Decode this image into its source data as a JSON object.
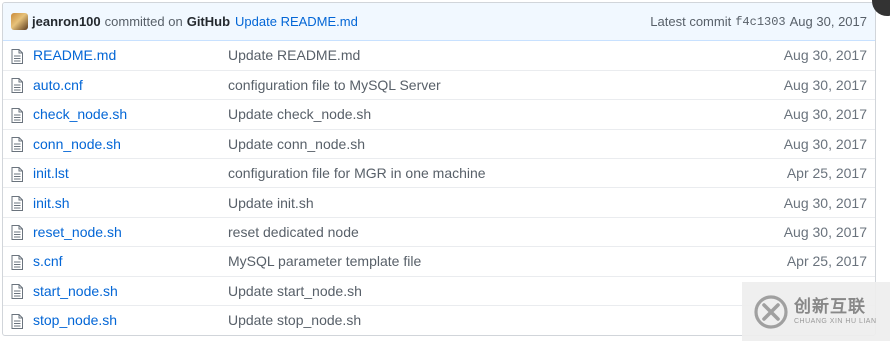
{
  "commit": {
    "author": "jeanron100",
    "committed_text": "committed on",
    "platform": "GitHub",
    "message": "Update README.md",
    "latest_label": "Latest commit",
    "sha": "f4c1303",
    "date": "Aug 30, 2017"
  },
  "files": [
    {
      "name": "README.md",
      "message": "Update README.md",
      "age": "Aug 30, 2017",
      "icon": "file-icon"
    },
    {
      "name": "auto.cnf",
      "message": "configuration file to MySQL Server",
      "age": "Aug 30, 2017",
      "icon": "file-icon"
    },
    {
      "name": "check_node.sh",
      "message": "Update check_node.sh",
      "age": "Aug 30, 2017",
      "icon": "file-icon"
    },
    {
      "name": "conn_node.sh",
      "message": "Update conn_node.sh",
      "age": "Aug 30, 2017",
      "icon": "file-icon"
    },
    {
      "name": "init.lst",
      "message": "configuration file for MGR in one machine",
      "age": "Apr 25, 2017",
      "icon": "file-icon"
    },
    {
      "name": "init.sh",
      "message": "Update init.sh",
      "age": "Aug 30, 2017",
      "icon": "file-icon"
    },
    {
      "name": "reset_node.sh",
      "message": "reset dedicated node",
      "age": "Aug 30, 2017",
      "icon": "file-icon"
    },
    {
      "name": "s.cnf",
      "message": "MySQL parameter template file",
      "age": "Apr 25, 2017",
      "icon": "file-icon"
    },
    {
      "name": "start_node.sh",
      "message": "Update start_node.sh",
      "age": "",
      "icon": "file-icon"
    },
    {
      "name": "stop_node.sh",
      "message": "Update stop_node.sh",
      "age": "",
      "icon": "file-icon"
    }
  ],
  "watermark": {
    "name": "创新互联",
    "pinyin": "CHUANG XIN HU LIAN"
  },
  "colors": {
    "link": "#0366d6",
    "commit_bar_bg": "#f1f8ff",
    "muted": "#586069"
  }
}
